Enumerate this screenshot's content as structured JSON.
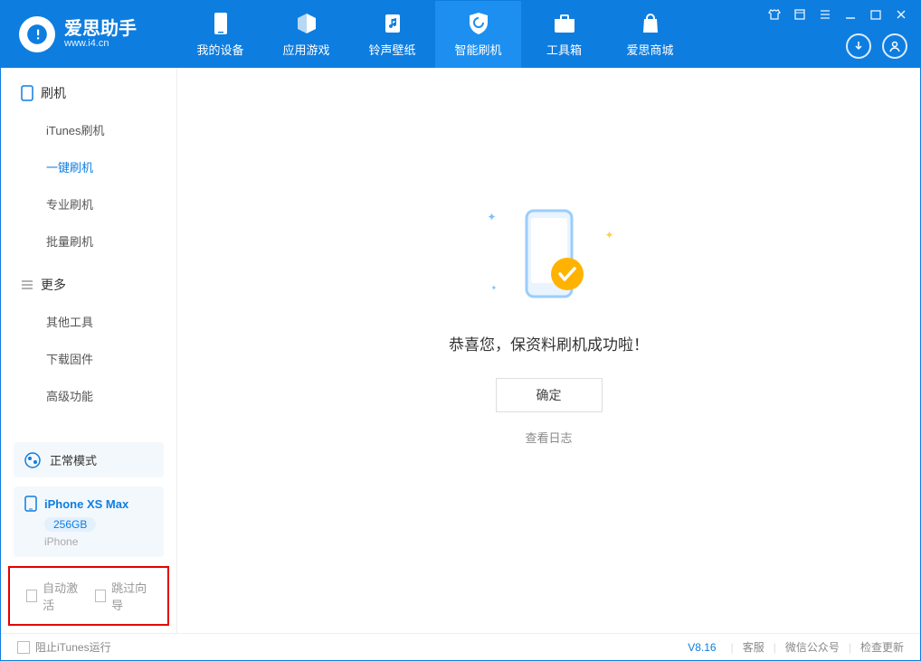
{
  "app": {
    "title": "爱思助手",
    "subtitle": "www.i4.cn"
  },
  "tabs": [
    {
      "label": "我的设备"
    },
    {
      "label": "应用游戏"
    },
    {
      "label": "铃声壁纸"
    },
    {
      "label": "智能刷机"
    },
    {
      "label": "工具箱"
    },
    {
      "label": "爱思商城"
    }
  ],
  "sidebar": {
    "section1": {
      "title": "刷机",
      "items": [
        "iTunes刷机",
        "一键刷机",
        "专业刷机",
        "批量刷机"
      ]
    },
    "section2": {
      "title": "更多",
      "items": [
        "其他工具",
        "下载固件",
        "高级功能"
      ]
    },
    "status": "正常模式",
    "device": {
      "name": "iPhone XS Max",
      "storage": "256GB",
      "type": "iPhone"
    },
    "checkbox1": "自动激活",
    "checkbox2": "跳过向导"
  },
  "main": {
    "success_msg": "恭喜您，保资料刷机成功啦！",
    "ok_button": "确定",
    "view_log": "查看日志"
  },
  "footer": {
    "block_itunes": "阻止iTunes运行",
    "version": "V8.16",
    "links": [
      "客服",
      "微信公众号",
      "检查更新"
    ]
  }
}
